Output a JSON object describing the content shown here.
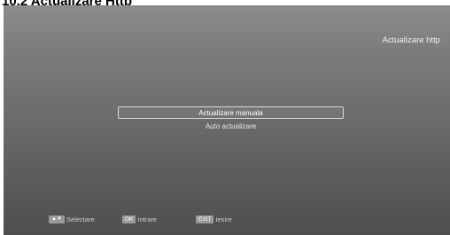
{
  "document": {
    "heading": "10.2 Actualizare Http"
  },
  "screen": {
    "title": "Actualizare http",
    "menu": [
      {
        "label": "Actualizare manuala",
        "selected": true
      },
      {
        "label": "Auto actualizare",
        "selected": false
      }
    ]
  },
  "footer": {
    "select_key_icon": "up-down-arrows-icon",
    "select_label": "Selectare",
    "ok_key": "OK",
    "ok_label": "Intrare",
    "exit_key": "EXIT",
    "exit_label": "Iesire"
  }
}
